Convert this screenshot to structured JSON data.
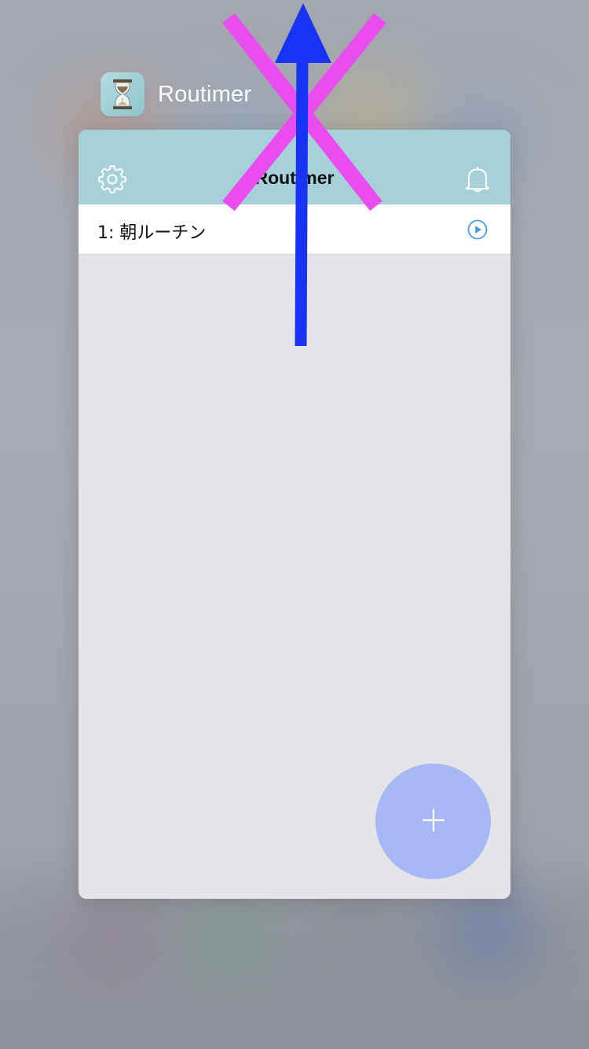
{
  "app_switcher": {
    "app_name": "Routimer",
    "app_icon": "hourglass-icon"
  },
  "app": {
    "navbar": {
      "title": "Routimer",
      "left_icon": "gear-icon",
      "right_icon": "bell-icon"
    },
    "routines": [
      {
        "label": "1: 朝ルーチン",
        "action_icon": "play-circle-icon"
      }
    ],
    "fab": {
      "label": "+",
      "icon": "plus-icon"
    }
  },
  "annotations": {
    "cross_mark": {
      "color": "#ea4cf0",
      "meaning": "close-x-icon"
    },
    "swipe_arrow": {
      "color": "#1733f5",
      "direction": "up",
      "icon": "arrow-up-icon"
    }
  },
  "colors": {
    "navbar_bg": "#a6d1d8",
    "card_bg": "#e5e4e9",
    "fab_bg": "#a6b8f6",
    "play_icon": "#4a9fe0"
  }
}
